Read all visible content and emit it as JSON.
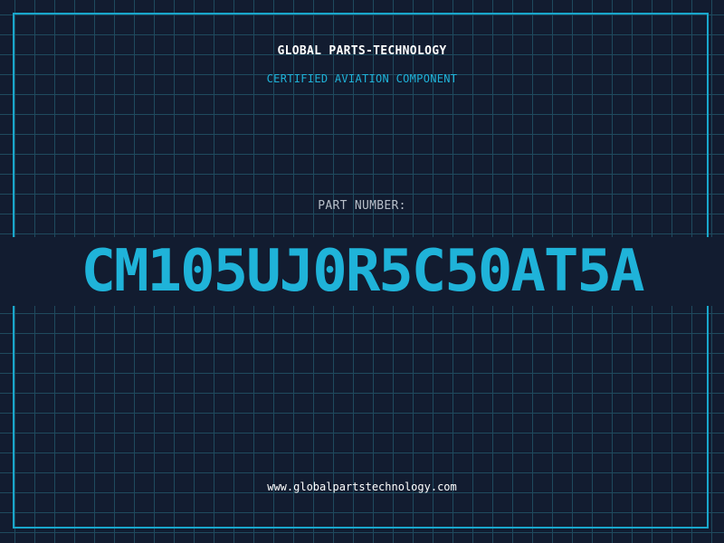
{
  "company_name": "GLOBAL PARTS-TECHNOLOGY",
  "subtitle": "CERTIFIED AVIATION COMPONENT",
  "part_number_label": "PART NUMBER:",
  "part_number": "CM105UJ0R5C50AT5A",
  "website": "www.globalpartstechnology.com",
  "colors": {
    "background": "#121c30",
    "grid": "#1f4a5e",
    "accent": "#1fb3d9",
    "label": "#b8bfc9",
    "text": "#ffffff"
  }
}
